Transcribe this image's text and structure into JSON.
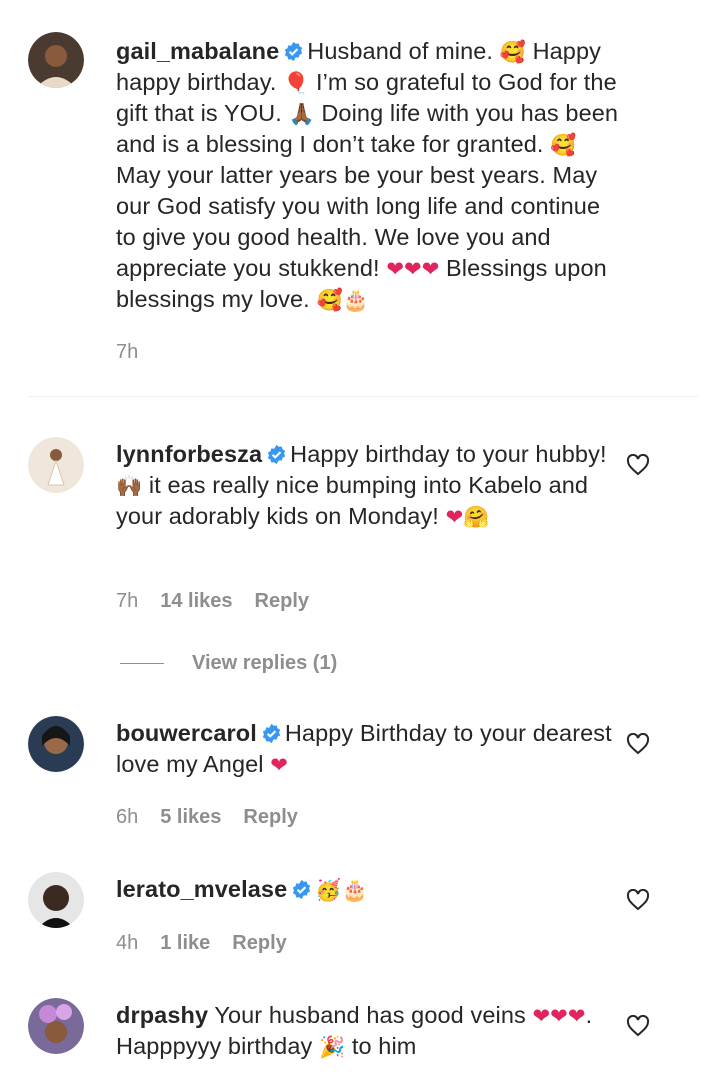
{
  "comments": [
    {
      "username": "gail_mabalane",
      "verified": true,
      "segments": [
        "Husband of mine. ",
        "🥰",
        " Happy happy birthday. ",
        "🎈",
        " I’m so grateful to God for the gift that is YOU. ",
        "🙏🏾",
        " Doing life with you has been and is a blessing I don’t take for granted. ",
        "🥰",
        " May your latter years be your best years. May our God satisfy you with long life and continue to give you good health. We love you and appreciate you stukkend! ",
        "❤❤❤",
        " Blessings upon blessings my love. ",
        "🥰🎂"
      ],
      "time": "7h"
    },
    {
      "username": "lynnforbesza",
      "verified": true,
      "segments": [
        "Happy birthday to your hubby! ",
        "🙌🏾",
        " it eas really nice bumping into Kabelo and your adorably kids on Monday! ",
        "❤🤗"
      ],
      "time": "7h",
      "likes": "14 likes",
      "reply": "Reply",
      "view_replies": "View replies (1)"
    },
    {
      "username": "bouwercarol",
      "verified": true,
      "segments": [
        "Happy Birthday to your dearest love my Angel ",
        "❤"
      ],
      "time": "6h",
      "likes": "5 likes",
      "reply": "Reply"
    },
    {
      "username": "lerato_mvelase",
      "verified": true,
      "segments": [
        "🥳🎂"
      ],
      "time": "4h",
      "likes": "1 like",
      "reply": "Reply"
    },
    {
      "username": "drpashy",
      "verified": false,
      "segments": [
        "Your husband has good veins ",
        "❤❤❤",
        ". Happpyyy birthday ",
        "🎉",
        " to him"
      ]
    }
  ],
  "colors": {
    "verified": "#3897f0",
    "heart": "#e0245e",
    "meta": "#8e8e8e"
  },
  "icons": {
    "like": "heart-outline-icon",
    "verified": "verified-badge-icon"
  }
}
